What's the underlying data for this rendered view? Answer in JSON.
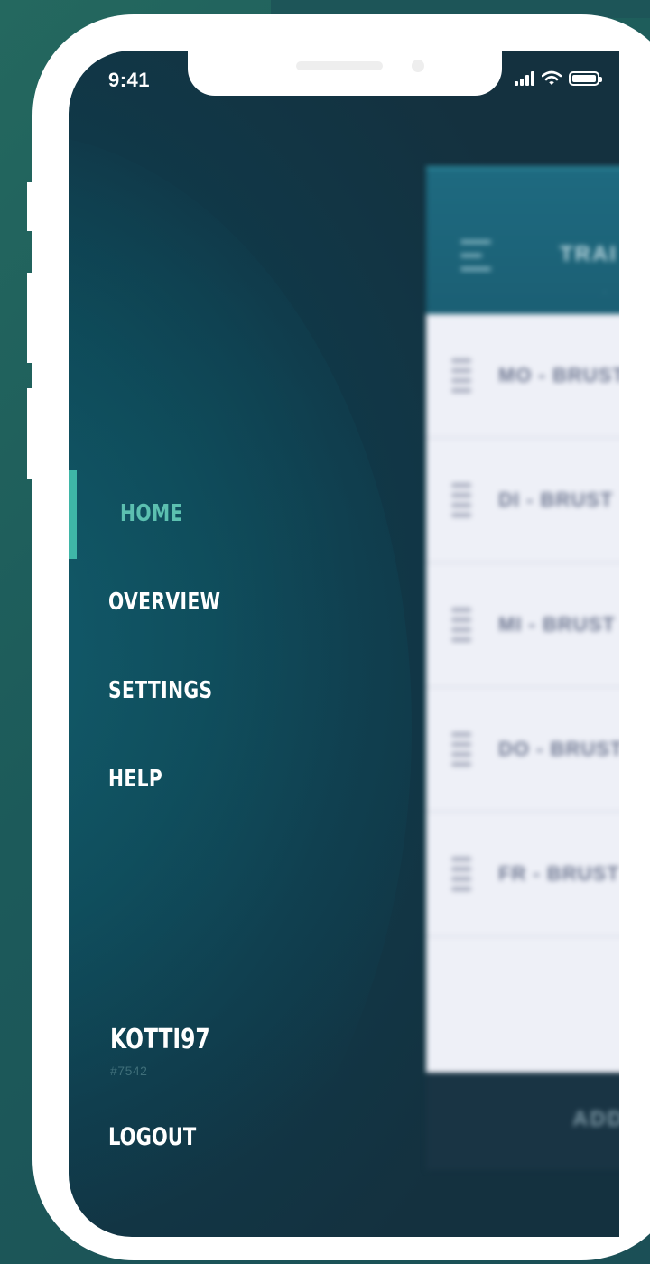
{
  "status_bar": {
    "time": "9:41",
    "icons": [
      "signal-icon",
      "wifi-icon",
      "battery-icon"
    ]
  },
  "drawer": {
    "items": [
      {
        "label": "HOME",
        "active": true
      },
      {
        "label": "OVERVIEW",
        "active": false
      },
      {
        "label": "SETTINGS",
        "active": false
      },
      {
        "label": "HELP",
        "active": false
      }
    ],
    "user": {
      "name": "KOTTI97",
      "tag": "#7542"
    },
    "logout_label": "LOGOUT"
  },
  "colors": {
    "accent": "#5cc0b0",
    "indicator": "#3fb6a7",
    "drawer_bg": "#0d4755",
    "outer_bg": "#24685f"
  }
}
